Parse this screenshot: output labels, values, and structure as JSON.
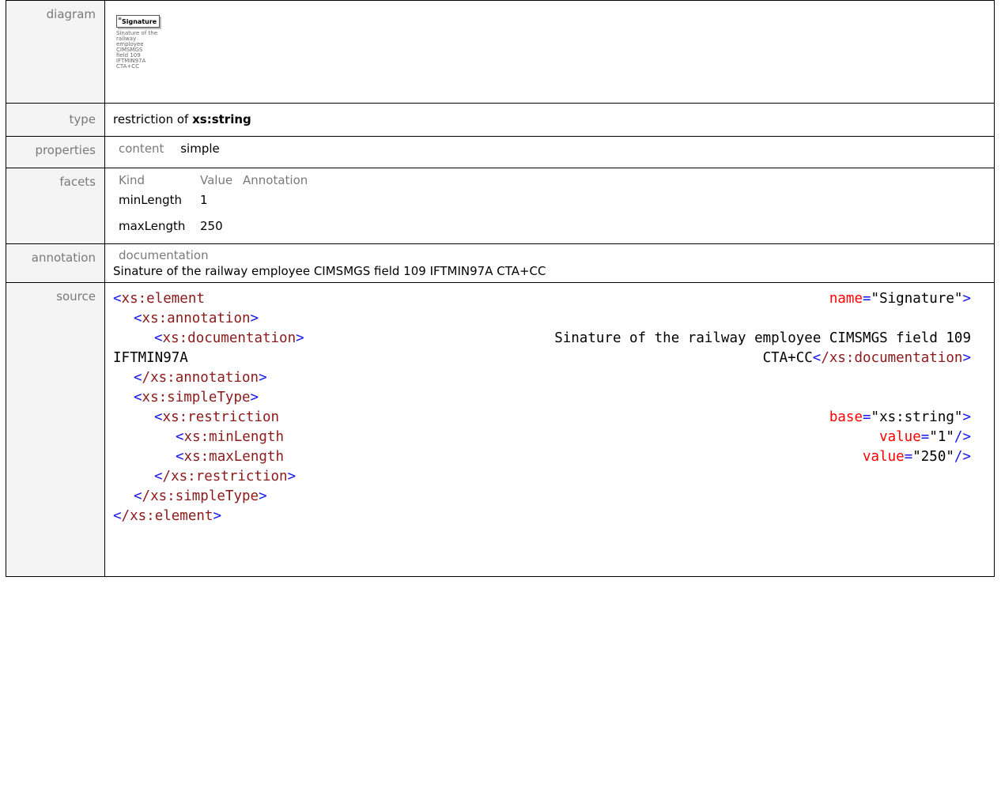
{
  "labels": {
    "diagram": "diagram",
    "type": "type",
    "properties": "properties",
    "facets": "facets",
    "annotation": "annotation",
    "source": "source"
  },
  "diagram": {
    "element_name": "Signature",
    "doc_lines": [
      "Sinature of the",
      "railway",
      "employee",
      "CIMSMGS",
      "field 109",
      "IFTMIN97A",
      "CTA+CC"
    ]
  },
  "type": {
    "prefix": "restriction of",
    "base": "xs:string"
  },
  "properties": {
    "key": "content",
    "value": "simple"
  },
  "facets": {
    "headers": [
      "Kind",
      "Value",
      "Annotation"
    ],
    "rows": [
      {
        "kind": "minLength",
        "value": "1"
      },
      {
        "kind": "maxLength",
        "value": "250"
      }
    ]
  },
  "annotation": {
    "key": "documentation",
    "text": "Sinature of the railway employee CIMSMGS field 109 IFTMIN97A CTA+CC"
  },
  "source": {
    "l1_tag": "xs:element",
    "l1_attr": "name",
    "l1_val": "\"Signature\"",
    "l2_tag": "xs:annotation",
    "l3_tag": "xs:documentation",
    "l3_text": "Sinature of the railway employee CIMSMGS field 109",
    "l4_text_a": "IFTMIN97A",
    "l4_text_b": "CTA+CC",
    "l4_close": "/xs:documentation",
    "l5_close": "/xs:annotation",
    "l6_tag": "xs:simpleType",
    "l7_tag": "xs:restriction",
    "l7_attr": "base",
    "l7_val": "\"xs:string\"",
    "l8_tag": "xs:minLength",
    "l8_attr": "value",
    "l8_val": "\"1\"",
    "l9_tag": "xs:maxLength",
    "l9_attr": "value",
    "l9_val": "\"250\"",
    "l10_close": "/xs:restriction",
    "l11_close": "/xs:simpleType",
    "l12_close": "/xs:element"
  }
}
